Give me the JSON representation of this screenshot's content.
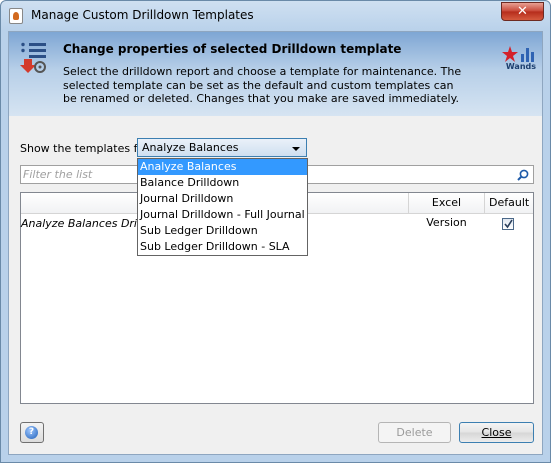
{
  "window": {
    "title": "Manage Custom Drilldown Templates",
    "close_symbol": "✕"
  },
  "header": {
    "title": "Change properties of selected Drilldown template",
    "description": "Select the drilldown report and choose a template for maintenance. The selected template can be set as the default and custom templates can be renamed or deleted. Changes that you make are saved immediately.",
    "logo_text": "Wands"
  },
  "selector": {
    "label": "Show the templates for",
    "value": "Analyze Balances",
    "options": [
      "Analyze Balances",
      "Balance Drilldown",
      "Journal Drilldown",
      "Journal Drilldown - Full Journal",
      "Sub Ledger Drilldown",
      "Sub Ledger Drilldown - SLA"
    ],
    "highlighted_index": 0
  },
  "filter": {
    "placeholder": "Filter the list"
  },
  "table": {
    "columns": [
      "",
      "Excel Version",
      "Default"
    ],
    "rows": [
      {
        "name": "Analyze Balances Drilldown",
        "excel_version": "",
        "default": true
      }
    ]
  },
  "buttons": {
    "help": "?",
    "delete": "Delete",
    "close": "Close"
  },
  "colors": {
    "selection": "#3399ff",
    "header_gradient_top": "#7ea6d4"
  }
}
